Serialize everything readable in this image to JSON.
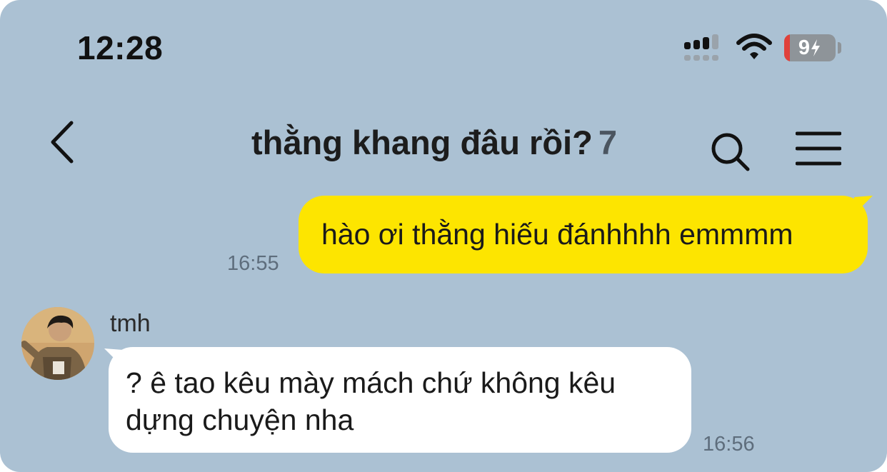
{
  "status_bar": {
    "time": "12:28",
    "battery_percent": "9",
    "battery_level": 0.09,
    "icons": [
      "cellular-signal-icon",
      "wifi-icon",
      "battery-charging-icon"
    ]
  },
  "nav": {
    "title": "thằng khang đâu rồi?",
    "member_count": "7",
    "icons": [
      "back-chevron-icon",
      "search-icon",
      "menu-icon"
    ]
  },
  "messages": [
    {
      "direction": "outgoing",
      "text": "hào ơi thằng hiếu đánhhhh emmmm",
      "time": "16:55"
    },
    {
      "direction": "incoming",
      "sender": "tmh",
      "text_lines": [
        "? ê tao kêu mày mách chứ không kêu",
        "dựng chuyện nha"
      ],
      "time": "16:56"
    }
  ],
  "colors": {
    "background": "#abc1d3",
    "outgoing_bubble": "#fde500",
    "incoming_bubble": "#ffffff",
    "battery_low": "#e0413b"
  }
}
